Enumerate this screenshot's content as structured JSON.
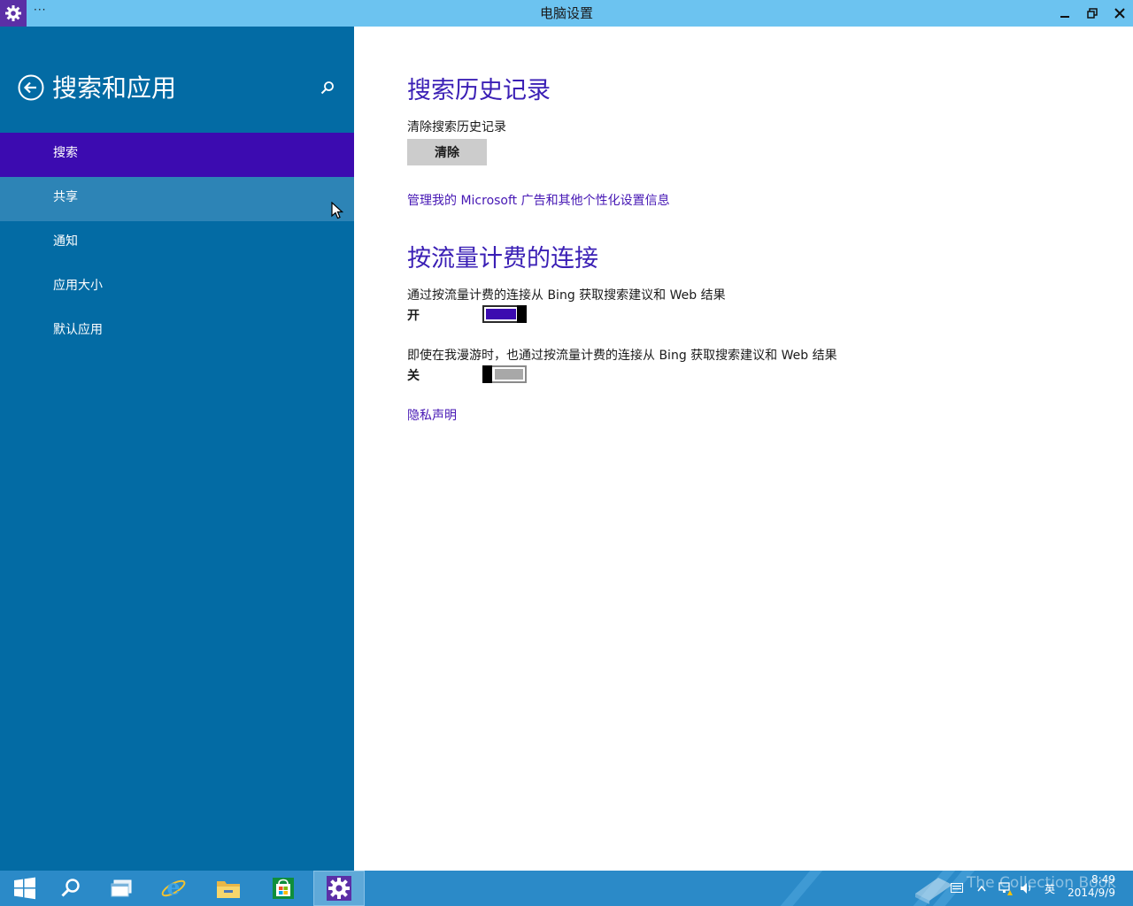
{
  "window": {
    "title": "电脑设置",
    "menu_label": "···",
    "app_icon": "gear-icon",
    "controls": [
      "minimize-icon",
      "restore-icon",
      "close-icon"
    ]
  },
  "sidebar": {
    "title": "搜索和应用",
    "back_icon": "back-arrow-icon",
    "search_icon": "search-icon",
    "items": [
      {
        "label": "搜索",
        "state": "selected"
      },
      {
        "label": "共享",
        "state": "hover"
      },
      {
        "label": "通知",
        "state": "normal"
      },
      {
        "label": "应用大小",
        "state": "normal"
      },
      {
        "label": "默认应用",
        "state": "normal"
      }
    ]
  },
  "main": {
    "history": {
      "heading": "搜索历史记录",
      "clear_label": "清除搜索历史记录",
      "clear_button": "清除",
      "manage_link": "管理我的 Microsoft 广告和其他个性化设置信息"
    },
    "metered": {
      "heading": "按流量计费的连接",
      "setting1": {
        "label": "通过按流量计费的连接从 Bing 获取搜索建议和 Web 结果",
        "state_text": "开",
        "on": true
      },
      "setting2": {
        "label": "即使在我漫游时，也通过按流量计费的连接从 Bing 获取搜索建议和 Web 结果",
        "state_text": "关",
        "on": false
      },
      "privacy_link": "隐私声明"
    }
  },
  "taskbar": {
    "items": [
      "windows-start-icon",
      "search-icon",
      "task-view-icon",
      "internet-explorer-icon",
      "file-explorer-icon",
      "store-icon",
      "settings-icon"
    ],
    "active_item": "settings-icon",
    "tray": {
      "ime": "英",
      "time": "8:49",
      "date": "2014/9/9"
    },
    "watermark": "The Collection Book"
  },
  "colors": {
    "titlebar": "#6cc3f0",
    "sidebar": "#036ba4",
    "selected": "#3c0bb0",
    "hover": "#2d84b6",
    "accent_text": "#3a1fb5",
    "taskbar": "#2b8ac8"
  }
}
